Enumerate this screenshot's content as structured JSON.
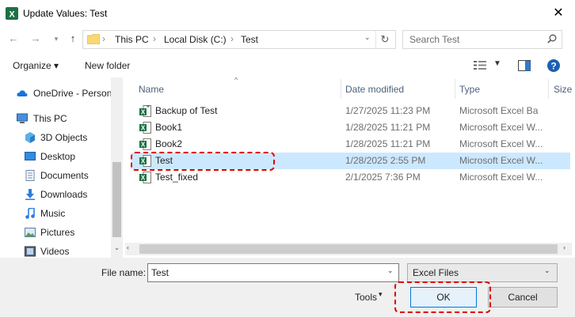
{
  "window": {
    "title": "Update Values: Test",
    "close_glyph": "✕"
  },
  "address": {
    "crumbs": [
      "This PC",
      "Local Disk (C:)",
      "Test"
    ],
    "separator": "›"
  },
  "search": {
    "placeholder": "Search Test"
  },
  "toolbar": {
    "organize": "Organize ▾",
    "new_folder": "New folder"
  },
  "nav": {
    "items": [
      {
        "label": "OneDrive - Person",
        "icon": "cloud-icon"
      },
      {
        "label": "This PC",
        "icon": "computer-icon"
      },
      {
        "label": "3D Objects",
        "icon": "cube-icon"
      },
      {
        "label": "Desktop",
        "icon": "desktop-icon"
      },
      {
        "label": "Documents",
        "icon": "documents-icon"
      },
      {
        "label": "Downloads",
        "icon": "download-icon"
      },
      {
        "label": "Music",
        "icon": "music-icon"
      },
      {
        "label": "Pictures",
        "icon": "pictures-icon"
      },
      {
        "label": "Videos",
        "icon": "videos-icon"
      }
    ]
  },
  "columns": {
    "name": "Name",
    "date": "Date modified",
    "type": "Type",
    "size": "Size"
  },
  "files": [
    {
      "name": "Backup of Test",
      "date": "1/27/2025 11:23 PM",
      "type": "Microsoft Excel Ba",
      "selected": false
    },
    {
      "name": "Book1",
      "date": "1/28/2025 11:21 PM",
      "type": "Microsoft Excel W...",
      "selected": false
    },
    {
      "name": "Book2",
      "date": "1/28/2025 11:21 PM",
      "type": "Microsoft Excel W...",
      "selected": false
    },
    {
      "name": "Test",
      "date": "1/28/2025 2:55 PM",
      "type": "Microsoft Excel W...",
      "selected": true
    },
    {
      "name": "Test_fixed",
      "date": "2/1/2025 7:36 PM",
      "type": "Microsoft Excel W...",
      "selected": false
    }
  ],
  "bottom": {
    "file_name_label": "File name:",
    "file_name_value": "Test",
    "file_type": "Excel Files",
    "tools": "Tools",
    "ok": "OK",
    "cancel": "Cancel"
  },
  "colors": {
    "selection": "#cce8ff",
    "highlight_dash": "#e00000",
    "excel_green": "#1d7044",
    "folder": "#f8d775"
  }
}
